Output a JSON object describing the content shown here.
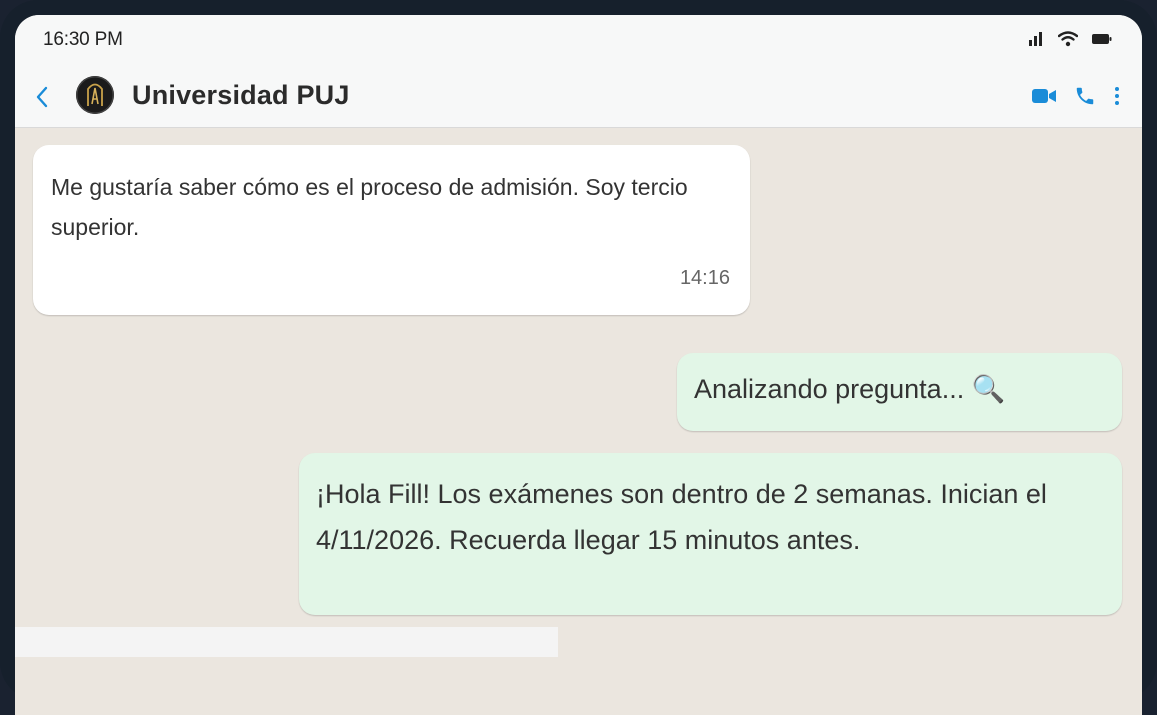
{
  "status_bar": {
    "time": "16:30 PM",
    "icons": [
      "signal-icon",
      "wifi-icon",
      "battery-icon"
    ]
  },
  "header": {
    "back_icon": "chevron-left-icon",
    "contact_name": "Universidad PUJ",
    "avatar_letter": "A",
    "actions": [
      "video-call-icon",
      "phone-icon",
      "more-vertical-icon"
    ],
    "accent_color": "#1a8cd8"
  },
  "messages": [
    {
      "direction": "incoming",
      "text": "Me gustaría saber cómo es el proceso de admisión. Soy tercio superior.",
      "time": "14:16"
    },
    {
      "direction": "outgoing",
      "text": "Analizando pregunta... 🔍"
    },
    {
      "direction": "outgoing",
      "text": "¡Hola Fill! Los exámenes son dentro de 2 semanas. Inician el 4/11/2026. Recuerda llegar 15 minutos antes."
    }
  ],
  "colors": {
    "chat_background": "#ebe6df",
    "incoming_bubble": "#ffffff",
    "outgoing_bubble": "#e2f6e7"
  }
}
